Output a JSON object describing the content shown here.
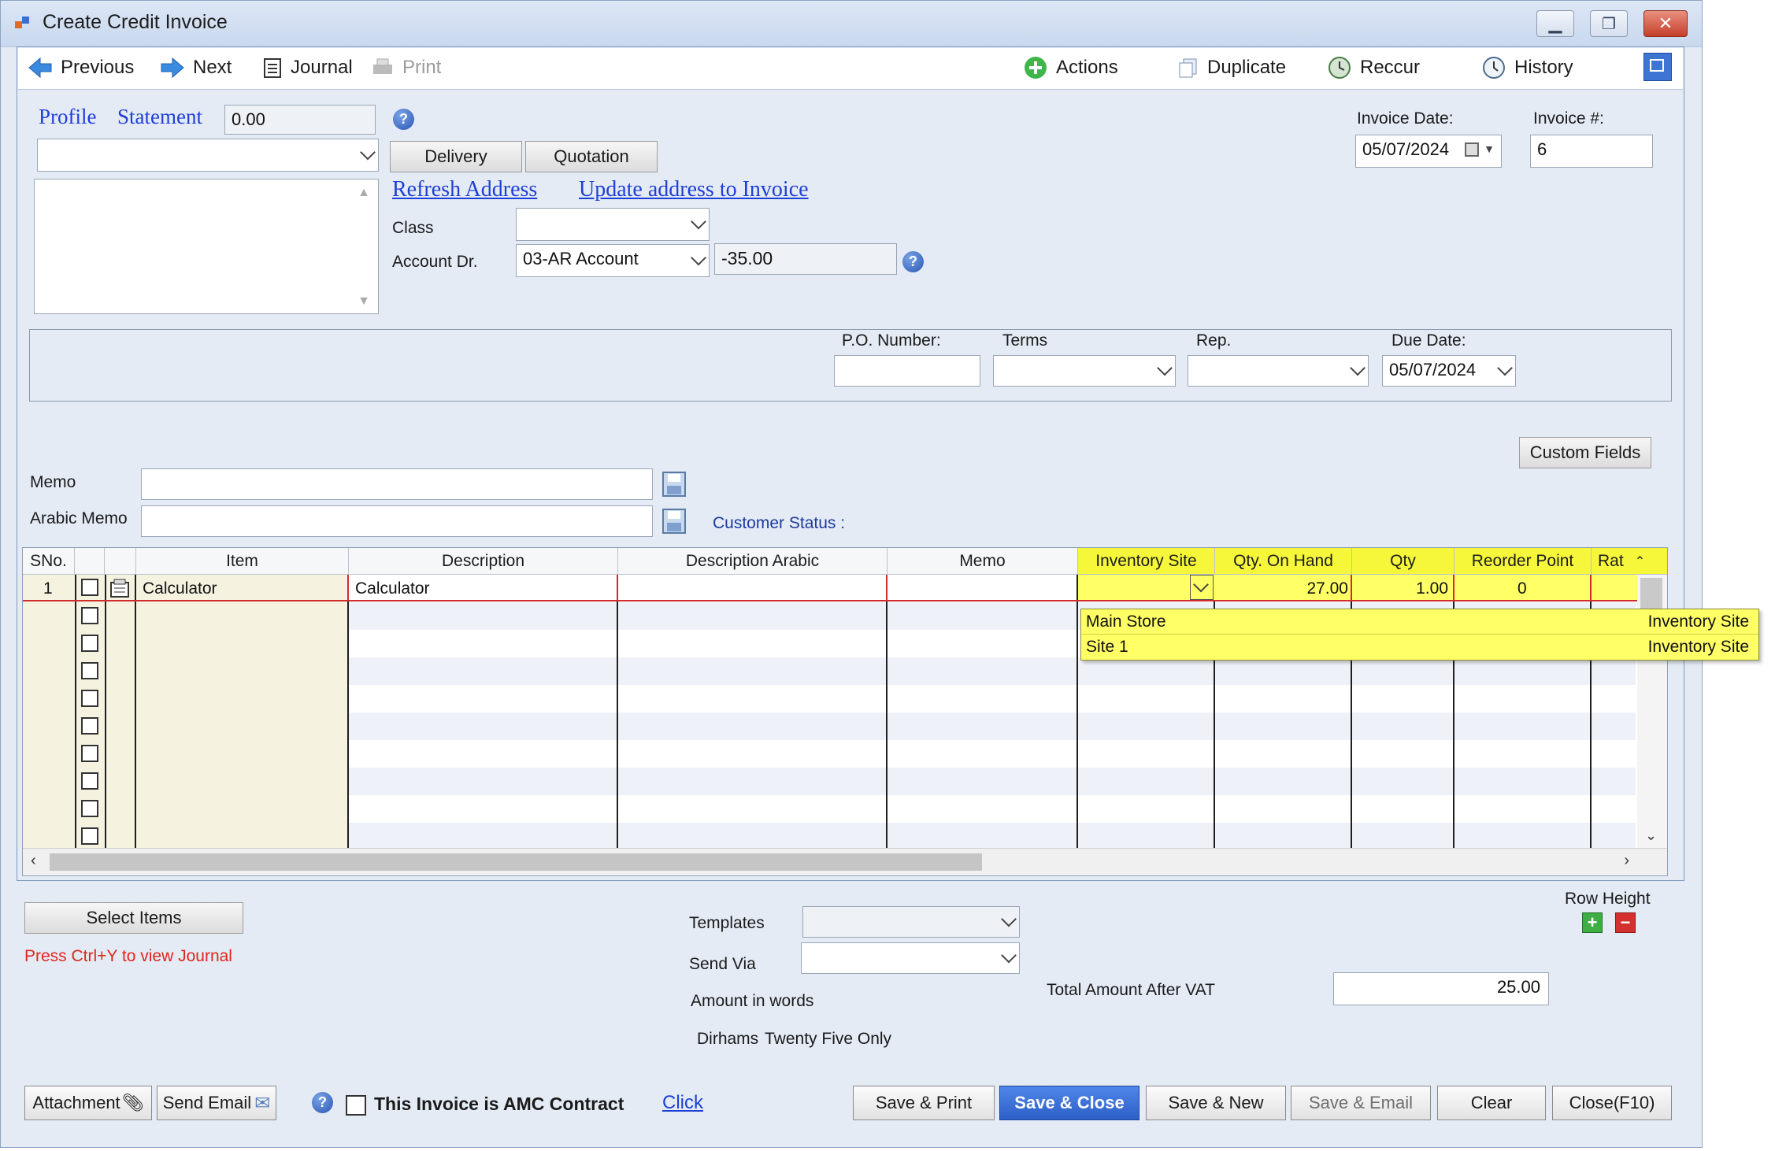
{
  "window": {
    "title": "Create Credit Invoice"
  },
  "toolbar": {
    "previous": "Previous",
    "next": "Next",
    "journal": "Journal",
    "print": "Print",
    "actions": "Actions",
    "duplicate": "Duplicate",
    "reccur": "Reccur",
    "history": "History"
  },
  "customer": {
    "profile": "Profile",
    "statement": "Statement",
    "balance": "0.00",
    "delivery": "Delivery",
    "quotation": "Quotation",
    "refresh_address": "Refresh Address",
    "update_address": "Update address to Invoice",
    "class_label": "Class",
    "account_label": "Account Dr.",
    "account_value": "03-AR Account",
    "account_balance": "-35.00"
  },
  "invoice": {
    "date_label": "Invoice Date:",
    "date": "05/07/2024",
    "number_label": "Invoice #:",
    "number": "6"
  },
  "shipping": {
    "po_label": "P.O. Number:",
    "terms_label": "Terms",
    "rep_label": "Rep.",
    "due_label": "Due Date:",
    "due_date": "05/07/2024"
  },
  "custom_fields": "Custom Fields",
  "memo": {
    "memo_label": "Memo",
    "arabic_label": "Arabic Memo",
    "status": "Customer Status :"
  },
  "grid": {
    "columns": [
      "SNo.",
      "Item",
      "Description",
      "Description Arabic",
      "Memo",
      "Inventory Site",
      "Qty. On Hand",
      "Qty",
      "Reorder Point",
      "Rat"
    ],
    "row1": {
      "sno": "1",
      "item": "Calculator",
      "description": "Calculator",
      "qty_on_hand": "27.00",
      "qty": "1.00",
      "reorder": "0"
    },
    "dropdown": [
      {
        "name": "Main Store",
        "type": "Inventory Site"
      },
      {
        "name": "Site 1",
        "type": "Inventory Site"
      }
    ]
  },
  "bottom": {
    "select_items": "Select Items",
    "journal_hint": "Press Ctrl+Y to view Journal",
    "templates_label": "Templates",
    "send_via_label": "Send Via",
    "amount_words_label": "Amount in words",
    "currency": "Dirhams",
    "amount_words": "Twenty Five Only",
    "total_label": "Total Amount After VAT",
    "total": "25.00",
    "row_height": "Row Height"
  },
  "footer": {
    "attachment": "Attachment",
    "send_email": "Send Email",
    "amc_label": "This Invoice is AMC Contract",
    "click": "Click",
    "save_print": "Save & Print",
    "save_close": "Save & Close",
    "save_new": "Save & New",
    "save_email": "Save & Email",
    "clear": "Clear",
    "close": "Close(F10)"
  }
}
